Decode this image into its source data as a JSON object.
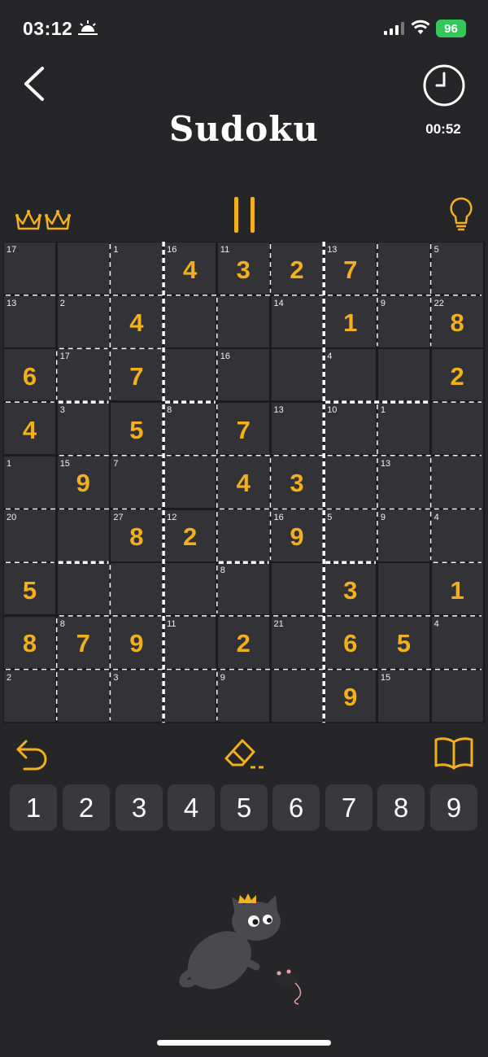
{
  "status_bar": {
    "time": "03:12",
    "battery": "96"
  },
  "header": {
    "title": "Sudoku",
    "timer": "00:52"
  },
  "grid": {
    "values": [
      [
        "",
        "",
        "",
        "4",
        "3",
        "2",
        "7",
        "",
        ""
      ],
      [
        "",
        "",
        "4",
        "",
        "",
        "",
        "1",
        "",
        "8"
      ],
      [
        "6",
        "",
        "7",
        "",
        "",
        "",
        "",
        "",
        "2"
      ],
      [
        "4",
        "",
        "5",
        "",
        "7",
        "",
        "",
        "",
        ""
      ],
      [
        "",
        "9",
        "",
        "",
        "4",
        "3",
        "",
        "",
        ""
      ],
      [
        "",
        "",
        "8",
        "2",
        "",
        "9",
        "",
        "",
        ""
      ],
      [
        "5",
        "",
        "",
        "",
        "",
        "",
        "3",
        "",
        "1"
      ],
      [
        "8",
        "7",
        "9",
        "",
        "2",
        "",
        "6",
        "5",
        ""
      ],
      [
        "",
        "",
        "",
        "",
        "",
        "",
        "9",
        "",
        ""
      ]
    ],
    "cage_sums": [
      [
        "17",
        "",
        "1",
        "16",
        "11",
        "",
        "13",
        "",
        "5"
      ],
      [
        "13",
        "2",
        "",
        "",
        "",
        "14",
        "",
        "9",
        "22"
      ],
      [
        "",
        "17",
        "",
        "",
        "16",
        "",
        "4",
        "",
        ""
      ],
      [
        "",
        "3",
        "",
        "8",
        "",
        "13",
        "10",
        "1",
        ""
      ],
      [
        "1",
        "15",
        "7",
        "",
        "",
        "",
        "",
        "13",
        ""
      ],
      [
        "20",
        "",
        "27",
        "12",
        "",
        "16",
        "5",
        "9",
        "4"
      ],
      [
        "",
        "",
        "",
        "",
        "8",
        "",
        "",
        "",
        ""
      ],
      [
        "",
        "8",
        "",
        "11",
        "",
        "21",
        "",
        "",
        "4"
      ],
      [
        "2",
        "",
        "3",
        "",
        "9",
        "",
        "",
        "15",
        ""
      ]
    ]
  },
  "keypad": {
    "digits": [
      "1",
      "2",
      "3",
      "4",
      "5",
      "6",
      "7",
      "8",
      "9"
    ]
  },
  "colors": {
    "accent": "#f2b01e",
    "background": "#262528",
    "cell": "#333236",
    "key": "#39383c"
  }
}
